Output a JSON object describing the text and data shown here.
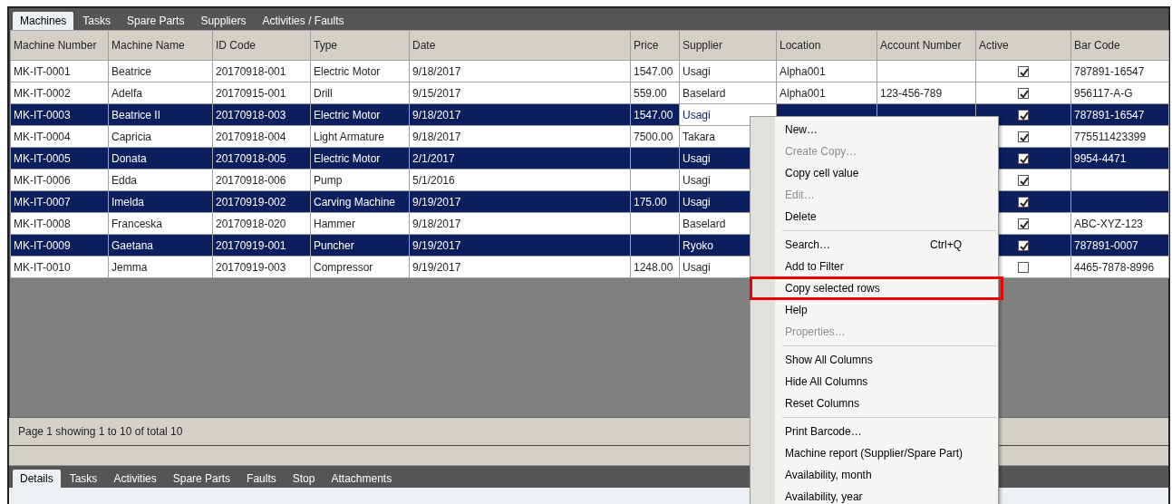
{
  "top_tabs": [
    {
      "label": "Machines",
      "selected": true
    },
    {
      "label": "Tasks",
      "selected": false
    },
    {
      "label": "Spare Parts",
      "selected": false
    },
    {
      "label": "Suppliers",
      "selected": false
    },
    {
      "label": "Activities / Faults",
      "selected": false
    }
  ],
  "table": {
    "columns": [
      {
        "label": "Machine Number",
        "kind": "text"
      },
      {
        "label": "Machine Name",
        "kind": "text"
      },
      {
        "label": "ID Code",
        "kind": "text"
      },
      {
        "label": "Type",
        "kind": "text"
      },
      {
        "label": "Date",
        "kind": "text"
      },
      {
        "label": "Price",
        "kind": "text"
      },
      {
        "label": "Supplier",
        "kind": "text"
      },
      {
        "label": "Location",
        "kind": "text"
      },
      {
        "label": "Account Number",
        "kind": "text"
      },
      {
        "label": "Active",
        "kind": "check"
      },
      {
        "label": "Bar Code",
        "kind": "text"
      }
    ],
    "rows": [
      {
        "selected": false,
        "cells": [
          "MK-IT-0001",
          "Beatrice",
          "20170918-001",
          "Electric Motor",
          "9/18/2017",
          "1547.00",
          "Usagi",
          "Alpha001",
          null,
          true,
          "787891-16547"
        ]
      },
      {
        "selected": false,
        "cells": [
          "MK-IT-0002",
          "Adelfa",
          "20170915-001",
          "Drill",
          "9/15/2017",
          "559.00",
          "Baselard",
          "Alpha001",
          "123-456-789",
          true,
          "956117-A-G"
        ]
      },
      {
        "selected": true,
        "cells": [
          "MK-IT-0003",
          "Beatrice II",
          "20170918-003",
          "Electric Motor",
          "9/18/2017",
          "1547.00",
          {
            "text": "Usagi",
            "focused": true
          },
          null,
          null,
          true,
          "787891-16547"
        ]
      },
      {
        "selected": false,
        "cells": [
          "MK-IT-0004",
          "Capricia",
          "20170918-004",
          "Light Armature",
          "9/18/2017",
          "7500.00",
          "Takara",
          null,
          null,
          true,
          "775511423399"
        ]
      },
      {
        "selected": true,
        "cells": [
          "MK-IT-0005",
          "Donata",
          "20170918-005",
          "Electric Motor",
          "2/1/2017",
          null,
          "Usagi",
          null,
          null,
          true,
          "9954-4471"
        ]
      },
      {
        "selected": false,
        "cells": [
          "MK-IT-0006",
          "Edda",
          "20170918-006",
          "Pump",
          "5/1/2016",
          null,
          "Usagi",
          null,
          null,
          true,
          null
        ]
      },
      {
        "selected": true,
        "cells": [
          "MK-IT-0007",
          "Imelda",
          "20170919-002",
          "Carving Machine",
          "9/19/2017",
          "175.00",
          "Usagi",
          null,
          null,
          true,
          null
        ]
      },
      {
        "selected": false,
        "cells": [
          "MK-IT-0008",
          "Franceska",
          "20170918-020",
          "Hammer",
          "9/18/2017",
          null,
          "Baselard",
          null,
          null,
          true,
          "ABC-XYZ-123"
        ]
      },
      {
        "selected": true,
        "cells": [
          "MK-IT-0009",
          "Gaetana",
          "20170919-001",
          "Puncher",
          "9/19/2017",
          null,
          "Ryoko",
          null,
          null,
          true,
          "787891-0007"
        ]
      },
      {
        "selected": false,
        "cells": [
          "MK-IT-0010",
          "Jemma",
          "20170919-003",
          "Compressor",
          "9/19/2017",
          "1248.00",
          "Usagi",
          null,
          null,
          false,
          "4465-7878-8996"
        ]
      }
    ]
  },
  "status_bar": "Page 1 showing 1 to 10 of total 10",
  "bottom_tabs": [
    {
      "label": "Details",
      "selected": true
    },
    {
      "label": "Tasks",
      "selected": false
    },
    {
      "label": "Activities",
      "selected": false
    },
    {
      "label": "Spare Parts",
      "selected": false
    },
    {
      "label": "Faults",
      "selected": false
    },
    {
      "label": "Stop",
      "selected": false
    },
    {
      "label": "Attachments",
      "selected": false
    }
  ],
  "context_menu": [
    {
      "kind": "item",
      "label": "New…",
      "disabled": false,
      "highlighted": false
    },
    {
      "kind": "item",
      "label": "Create Copy…",
      "disabled": true,
      "highlighted": false
    },
    {
      "kind": "item",
      "label": "Copy cell value",
      "disabled": false,
      "highlighted": false
    },
    {
      "kind": "item",
      "label": "Edit…",
      "disabled": true,
      "highlighted": false
    },
    {
      "kind": "item",
      "label": "Delete",
      "disabled": false,
      "highlighted": false
    },
    {
      "kind": "separator"
    },
    {
      "kind": "item",
      "label": "Search…",
      "shortcut": "Ctrl+Q",
      "disabled": false,
      "highlighted": false
    },
    {
      "kind": "item",
      "label": "Add to Filter",
      "disabled": false,
      "highlighted": false
    },
    {
      "kind": "item",
      "label": "Copy selected rows",
      "disabled": false,
      "highlighted": true
    },
    {
      "kind": "item",
      "label": "Help",
      "disabled": false,
      "highlighted": false
    },
    {
      "kind": "item",
      "label": "Properties…",
      "disabled": true,
      "highlighted": false
    },
    {
      "kind": "separator"
    },
    {
      "kind": "item",
      "label": "Show All Columns",
      "disabled": false,
      "highlighted": false
    },
    {
      "kind": "item",
      "label": "Hide All Columns",
      "disabled": false,
      "highlighted": false
    },
    {
      "kind": "item",
      "label": "Reset Columns",
      "disabled": false,
      "highlighted": false
    },
    {
      "kind": "separator"
    },
    {
      "kind": "item",
      "label": "Print Barcode…",
      "disabled": false,
      "highlighted": false
    },
    {
      "kind": "item",
      "label": "Machine report (Supplier/Spare Part)",
      "disabled": false,
      "highlighted": false
    },
    {
      "kind": "item",
      "label": "Availability, month",
      "disabled": false,
      "highlighted": false
    },
    {
      "kind": "item",
      "label": "Availability, year",
      "disabled": false,
      "highlighted": false
    }
  ]
}
